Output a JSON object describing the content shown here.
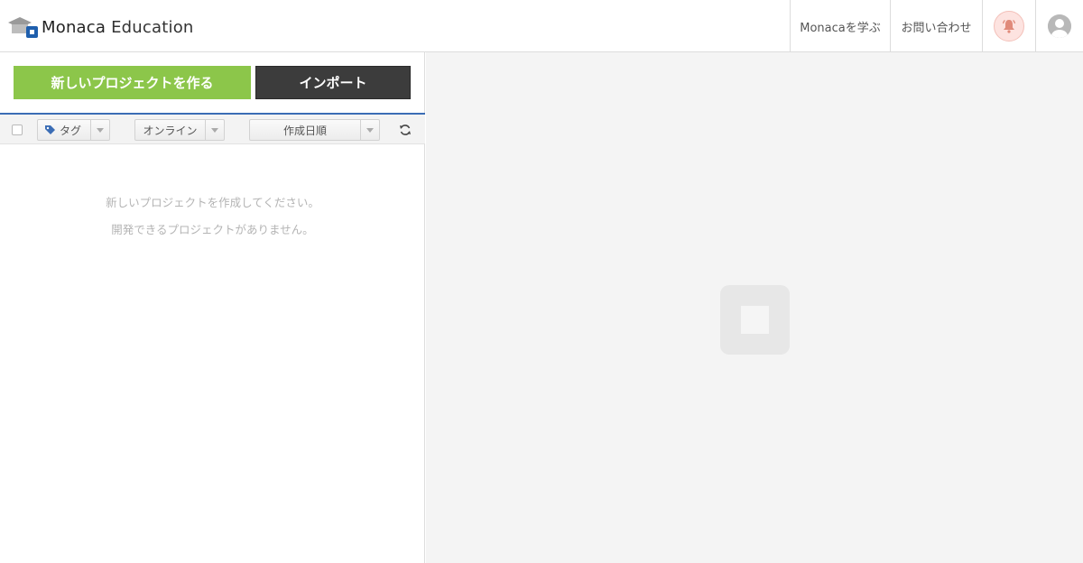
{
  "header": {
    "brand": "Monaca",
    "product": "Education",
    "nav": {
      "learn_label": "Monacaを学ぶ",
      "contact_label": "お問い合わせ"
    },
    "icons": {
      "logo": "graduation-cap-logo-icon",
      "bell": "bell-icon",
      "user": "user-avatar-icon"
    }
  },
  "actions": {
    "new_project_label": "新しいプロジェクトを作る",
    "import_label": "インポート"
  },
  "toolbar": {
    "tag_label": "タグ",
    "online_label": "オンライン",
    "sort_label": "作成日順",
    "refresh_icon": "refresh-icon"
  },
  "empty_state": {
    "line1": "新しいプロジェクトを作成してください。",
    "line2": "開発できるプロジェクトがありません。"
  },
  "colors": {
    "primary_green": "#8cc64a",
    "dark_button": "#3c3c3c",
    "accent_blue": "#3b6db5",
    "bell_bg": "#fde3e0",
    "bell_icon": "#e08a7a",
    "right_panel_bg": "#f4f4f4"
  }
}
